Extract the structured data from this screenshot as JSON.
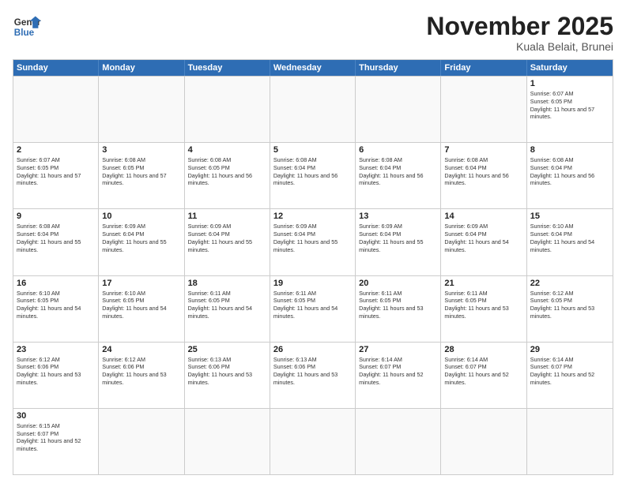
{
  "header": {
    "logo_general": "General",
    "logo_blue": "Blue",
    "month_title": "November 2025",
    "location": "Kuala Belait, Brunei"
  },
  "days_of_week": [
    "Sunday",
    "Monday",
    "Tuesday",
    "Wednesday",
    "Thursday",
    "Friday",
    "Saturday"
  ],
  "weeks": [
    [
      {
        "day": "",
        "sunrise": "",
        "sunset": "",
        "daylight": "",
        "empty": true
      },
      {
        "day": "",
        "sunrise": "",
        "sunset": "",
        "daylight": "",
        "empty": true
      },
      {
        "day": "",
        "sunrise": "",
        "sunset": "",
        "daylight": "",
        "empty": true
      },
      {
        "day": "",
        "sunrise": "",
        "sunset": "",
        "daylight": "",
        "empty": true
      },
      {
        "day": "",
        "sunrise": "",
        "sunset": "",
        "daylight": "",
        "empty": true
      },
      {
        "day": "",
        "sunrise": "",
        "sunset": "",
        "daylight": "",
        "empty": true
      },
      {
        "day": "1",
        "sunrise": "Sunrise: 6:07 AM",
        "sunset": "Sunset: 6:05 PM",
        "daylight": "Daylight: 11 hours and 57 minutes.",
        "empty": false
      }
    ],
    [
      {
        "day": "2",
        "sunrise": "Sunrise: 6:07 AM",
        "sunset": "Sunset: 6:05 PM",
        "daylight": "Daylight: 11 hours and 57 minutes.",
        "empty": false
      },
      {
        "day": "3",
        "sunrise": "Sunrise: 6:08 AM",
        "sunset": "Sunset: 6:05 PM",
        "daylight": "Daylight: 11 hours and 57 minutes.",
        "empty": false
      },
      {
        "day": "4",
        "sunrise": "Sunrise: 6:08 AM",
        "sunset": "Sunset: 6:05 PM",
        "daylight": "Daylight: 11 hours and 56 minutes.",
        "empty": false
      },
      {
        "day": "5",
        "sunrise": "Sunrise: 6:08 AM",
        "sunset": "Sunset: 6:04 PM",
        "daylight": "Daylight: 11 hours and 56 minutes.",
        "empty": false
      },
      {
        "day": "6",
        "sunrise": "Sunrise: 6:08 AM",
        "sunset": "Sunset: 6:04 PM",
        "daylight": "Daylight: 11 hours and 56 minutes.",
        "empty": false
      },
      {
        "day": "7",
        "sunrise": "Sunrise: 6:08 AM",
        "sunset": "Sunset: 6:04 PM",
        "daylight": "Daylight: 11 hours and 56 minutes.",
        "empty": false
      },
      {
        "day": "8",
        "sunrise": "Sunrise: 6:08 AM",
        "sunset": "Sunset: 6:04 PM",
        "daylight": "Daylight: 11 hours and 56 minutes.",
        "empty": false
      }
    ],
    [
      {
        "day": "9",
        "sunrise": "Sunrise: 6:08 AM",
        "sunset": "Sunset: 6:04 PM",
        "daylight": "Daylight: 11 hours and 55 minutes.",
        "empty": false
      },
      {
        "day": "10",
        "sunrise": "Sunrise: 6:09 AM",
        "sunset": "Sunset: 6:04 PM",
        "daylight": "Daylight: 11 hours and 55 minutes.",
        "empty": false
      },
      {
        "day": "11",
        "sunrise": "Sunrise: 6:09 AM",
        "sunset": "Sunset: 6:04 PM",
        "daylight": "Daylight: 11 hours and 55 minutes.",
        "empty": false
      },
      {
        "day": "12",
        "sunrise": "Sunrise: 6:09 AM",
        "sunset": "Sunset: 6:04 PM",
        "daylight": "Daylight: 11 hours and 55 minutes.",
        "empty": false
      },
      {
        "day": "13",
        "sunrise": "Sunrise: 6:09 AM",
        "sunset": "Sunset: 6:04 PM",
        "daylight": "Daylight: 11 hours and 55 minutes.",
        "empty": false
      },
      {
        "day": "14",
        "sunrise": "Sunrise: 6:09 AM",
        "sunset": "Sunset: 6:04 PM",
        "daylight": "Daylight: 11 hours and 54 minutes.",
        "empty": false
      },
      {
        "day": "15",
        "sunrise": "Sunrise: 6:10 AM",
        "sunset": "Sunset: 6:04 PM",
        "daylight": "Daylight: 11 hours and 54 minutes.",
        "empty": false
      }
    ],
    [
      {
        "day": "16",
        "sunrise": "Sunrise: 6:10 AM",
        "sunset": "Sunset: 6:05 PM",
        "daylight": "Daylight: 11 hours and 54 minutes.",
        "empty": false
      },
      {
        "day": "17",
        "sunrise": "Sunrise: 6:10 AM",
        "sunset": "Sunset: 6:05 PM",
        "daylight": "Daylight: 11 hours and 54 minutes.",
        "empty": false
      },
      {
        "day": "18",
        "sunrise": "Sunrise: 6:11 AM",
        "sunset": "Sunset: 6:05 PM",
        "daylight": "Daylight: 11 hours and 54 minutes.",
        "empty": false
      },
      {
        "day": "19",
        "sunrise": "Sunrise: 6:11 AM",
        "sunset": "Sunset: 6:05 PM",
        "daylight": "Daylight: 11 hours and 54 minutes.",
        "empty": false
      },
      {
        "day": "20",
        "sunrise": "Sunrise: 6:11 AM",
        "sunset": "Sunset: 6:05 PM",
        "daylight": "Daylight: 11 hours and 53 minutes.",
        "empty": false
      },
      {
        "day": "21",
        "sunrise": "Sunrise: 6:11 AM",
        "sunset": "Sunset: 6:05 PM",
        "daylight": "Daylight: 11 hours and 53 minutes.",
        "empty": false
      },
      {
        "day": "22",
        "sunrise": "Sunrise: 6:12 AM",
        "sunset": "Sunset: 6:05 PM",
        "daylight": "Daylight: 11 hours and 53 minutes.",
        "empty": false
      }
    ],
    [
      {
        "day": "23",
        "sunrise": "Sunrise: 6:12 AM",
        "sunset": "Sunset: 6:06 PM",
        "daylight": "Daylight: 11 hours and 53 minutes.",
        "empty": false
      },
      {
        "day": "24",
        "sunrise": "Sunrise: 6:12 AM",
        "sunset": "Sunset: 6:06 PM",
        "daylight": "Daylight: 11 hours and 53 minutes.",
        "empty": false
      },
      {
        "day": "25",
        "sunrise": "Sunrise: 6:13 AM",
        "sunset": "Sunset: 6:06 PM",
        "daylight": "Daylight: 11 hours and 53 minutes.",
        "empty": false
      },
      {
        "day": "26",
        "sunrise": "Sunrise: 6:13 AM",
        "sunset": "Sunset: 6:06 PM",
        "daylight": "Daylight: 11 hours and 53 minutes.",
        "empty": false
      },
      {
        "day": "27",
        "sunrise": "Sunrise: 6:14 AM",
        "sunset": "Sunset: 6:07 PM",
        "daylight": "Daylight: 11 hours and 52 minutes.",
        "empty": false
      },
      {
        "day": "28",
        "sunrise": "Sunrise: 6:14 AM",
        "sunset": "Sunset: 6:07 PM",
        "daylight": "Daylight: 11 hours and 52 minutes.",
        "empty": false
      },
      {
        "day": "29",
        "sunrise": "Sunrise: 6:14 AM",
        "sunset": "Sunset: 6:07 PM",
        "daylight": "Daylight: 11 hours and 52 minutes.",
        "empty": false
      }
    ],
    [
      {
        "day": "30",
        "sunrise": "Sunrise: 6:15 AM",
        "sunset": "Sunset: 6:07 PM",
        "daylight": "Daylight: 11 hours and 52 minutes.",
        "empty": false
      },
      {
        "day": "",
        "sunrise": "",
        "sunset": "",
        "daylight": "",
        "empty": true
      },
      {
        "day": "",
        "sunrise": "",
        "sunset": "",
        "daylight": "",
        "empty": true
      },
      {
        "day": "",
        "sunrise": "",
        "sunset": "",
        "daylight": "",
        "empty": true
      },
      {
        "day": "",
        "sunrise": "",
        "sunset": "",
        "daylight": "",
        "empty": true
      },
      {
        "day": "",
        "sunrise": "",
        "sunset": "",
        "daylight": "",
        "empty": true
      },
      {
        "day": "",
        "sunrise": "",
        "sunset": "",
        "daylight": "",
        "empty": true
      }
    ]
  ]
}
